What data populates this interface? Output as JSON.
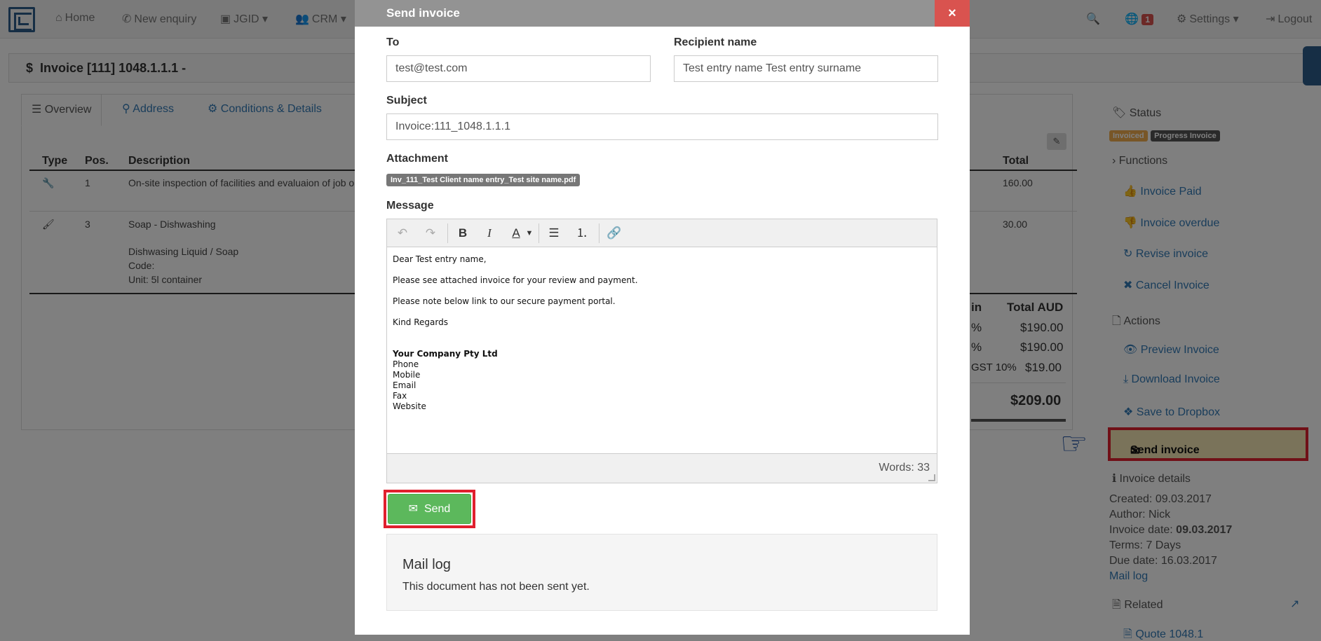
{
  "nav": {
    "home": "Home",
    "new_enquiry": "New enquiry",
    "jgid": "JGID",
    "crm": "CRM",
    "notifications_count": "1",
    "settings": "Settings",
    "logout": "Logout"
  },
  "page": {
    "title": "Invoice [111] 1048.1.1.1 -",
    "tabs": [
      "Overview",
      "Address",
      "Conditions & Details"
    ]
  },
  "table": {
    "headers": {
      "type": "Type",
      "pos": "Pos.",
      "description": "Description",
      "total": "Total"
    },
    "rows": [
      {
        "pos": "1",
        "description": "On-site inspection of facilities and evaluaion of job o",
        "total": "160.00"
      },
      {
        "pos": "3",
        "description": "Soap - Dishwashing",
        "total": "30.00",
        "detail1": "Dishwasing Liquid / Soap",
        "detail2": "Code:",
        "detail3": "Unit: 5l container"
      }
    ],
    "totals": {
      "header_left": "in",
      "header_right": "Total AUD",
      "row1_left": "%",
      "row1_value": "$190.00",
      "row2_left": "%",
      "row2_value": "$190.00",
      "row3_left": "GST 10%",
      "row3_value": "$19.00",
      "grand": "$209.00"
    }
  },
  "sidebar": {
    "status": "Status",
    "status_badges": [
      "Invoiced",
      "Progress Invoice"
    ],
    "functions": "Functions",
    "function_links": [
      "Invoice Paid",
      "Invoice overdue",
      "Revise invoice",
      "Cancel Invoice"
    ],
    "actions": "Actions",
    "action_links": [
      "Preview Invoice",
      "Download Invoice",
      "Save to Dropbox"
    ],
    "send_invoice": "Send invoice",
    "invoice_details": "Invoice details",
    "created": "Created: 09.03.2017",
    "author": "Author: Nick",
    "invoice_date_label": "Invoice date: ",
    "invoice_date_value": "09.03.2017",
    "terms": "Terms: 7 Days",
    "due_date": "Due date: 16.03.2017",
    "mail_log": "Mail log",
    "related": "Related",
    "related_link": "Quote 1048.1"
  },
  "modal": {
    "title": "Send invoice",
    "close": "×",
    "to_label": "To",
    "to_value": "test@test.com",
    "recipient_label": "Recipient name",
    "recipient_value": "Test entry name Test entry surname",
    "subject_label": "Subject",
    "subject_value": "Invoice:111_1048.1.1.1",
    "attachment_label": "Attachment",
    "attachment_file": "Inv_111_Test Client name entry_Test site name.pdf",
    "message_label": "Message",
    "message": {
      "greeting": "Dear Test entry name,",
      "line1": "Please see attached invoice for your review and payment.",
      "line2": "Please note below link to our secure payment portal.",
      "closing": "Kind Regards",
      "company": "Your Company Pty Ltd",
      "sig": [
        "Phone",
        "Mobile",
        "Email",
        "Fax",
        "Website"
      ]
    },
    "words": "Words: 33",
    "send_button": "Send",
    "mail_log_title": "Mail log",
    "mail_log_text": "This document has not been sent yet."
  },
  "colors": {
    "accent_link": "#337ab7",
    "send_green": "#5cb85c",
    "close_red": "#d9534f",
    "highlight_red": "#e0202e",
    "highlight_fill": "#f4e6b5"
  }
}
